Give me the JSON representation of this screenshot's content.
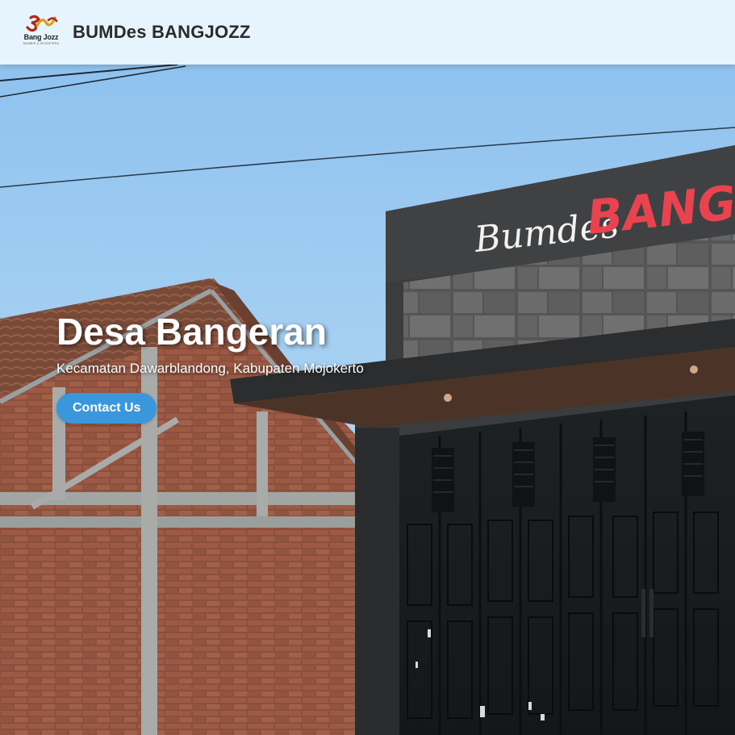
{
  "navbar": {
    "logo_icon": "bang-jozz-logo",
    "logo_text": "Bang Jozz",
    "logo_tagline": "MAMBIR & SEJAHTERA",
    "brand": "BUMDes BANGJOZZ"
  },
  "hero": {
    "title": "Desa Bangeran",
    "subtitle": "Kecamatan Dawarblandong, Kabupaten Mojokerto",
    "cta_label": "Contact Us",
    "photo": {
      "sign_script": "Bumdes",
      "sign_bold": "BANG-"
    }
  },
  "colors": {
    "navbar_bg": "#e6f5fd",
    "cta_bg": "#3a97dc",
    "sign_red": "#e8434f"
  }
}
